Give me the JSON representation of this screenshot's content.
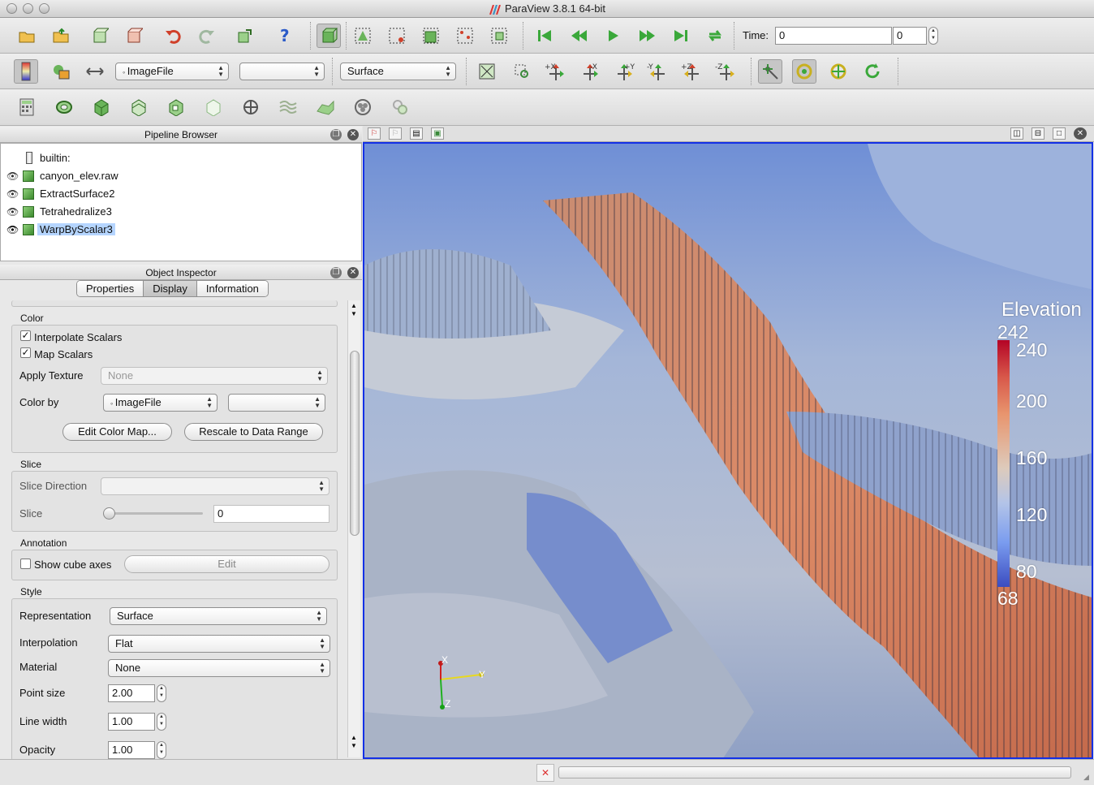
{
  "window": {
    "title": "ParaView 3.8.1 64-bit"
  },
  "toolbar1": {
    "time_label": "Time:",
    "time_value": "0",
    "timestep_value": "0",
    "icons": [
      "open-file-icon",
      "open-folder-icon",
      "load-state-icon",
      "save-state-icon",
      "undo-icon",
      "redo-icon",
      "connect-icon",
      "help-icon",
      "interact-icon",
      "select-cells-surface-icon",
      "select-points-surface-icon",
      "select-cells-frustum-icon",
      "select-points-frustum-icon",
      "select-block-icon",
      "first-frame-icon",
      "previous-frame-icon",
      "play-icon",
      "next-frame-icon",
      "last-frame-icon",
      "loop-icon"
    ]
  },
  "toolbar2": {
    "color_array": "ImageFile",
    "component": "",
    "representation": "Surface",
    "camera_buttons": [
      "+X",
      "-X",
      "+Y",
      "-Y",
      "+Z",
      "-Z"
    ]
  },
  "toolbar3": {
    "icons": [
      "calculator-icon",
      "contour-icon",
      "clip-icon",
      "slice-icon",
      "threshold-icon",
      "extract-subset-icon",
      "glyph-icon",
      "stream-tracer-icon",
      "warp-icon",
      "group-icon",
      "extract-level-icon"
    ]
  },
  "pipeline": {
    "title": "Pipeline Browser",
    "server": "builtin:",
    "items": [
      {
        "name": "canyon_elev.raw",
        "selected": false
      },
      {
        "name": "ExtractSurface2",
        "selected": false
      },
      {
        "name": "Tetrahedralize3",
        "selected": false
      },
      {
        "name": "WarpByScalar3",
        "selected": true
      }
    ]
  },
  "inspector": {
    "title": "Object Inspector",
    "tabs": [
      {
        "label": "Properties",
        "active": false
      },
      {
        "label": "Display",
        "active": true
      },
      {
        "label": "Information",
        "active": false
      }
    ],
    "color": {
      "group": "Color",
      "interpolate_scalars": "Interpolate Scalars",
      "map_scalars": "Map Scalars",
      "apply_texture_label": "Apply Texture",
      "apply_texture_value": "None",
      "color_by_label": "Color by",
      "color_by_value": "ImageFile",
      "color_by_component": "",
      "edit_color_map": "Edit Color Map...",
      "rescale": "Rescale to Data Range"
    },
    "slice": {
      "group": "Slice",
      "direction_label": "Slice Direction",
      "direction_value": "",
      "slice_label": "Slice",
      "slice_value": "0",
      "slider_level": 0
    },
    "annotation": {
      "group": "Annotation",
      "show_cube_axes": "Show cube axes",
      "edit": "Edit"
    },
    "style": {
      "group": "Style",
      "representation_label": "Representation",
      "representation_value": "Surface",
      "interpolation_label": "Interpolation",
      "interpolation_value": "Flat",
      "material_label": "Material",
      "material_value": "None",
      "point_size_label": "Point size",
      "point_size_value": "2.00",
      "line_width_label": "Line width",
      "line_width_value": "1.00",
      "opacity_label": "Opacity",
      "opacity_value": "1.00"
    }
  },
  "view": {
    "legend": {
      "title": "Elevation",
      "max": "242",
      "min": "68",
      "ticks": [
        "240",
        "200",
        "160",
        "120",
        "80"
      ]
    },
    "axes": {
      "x": "X",
      "y": "Y",
      "z": "Z"
    },
    "colors": {
      "high": "#b40426",
      "mid": "#dddddd",
      "low": "#3b4cc0",
      "border": "#1330e6"
    }
  }
}
